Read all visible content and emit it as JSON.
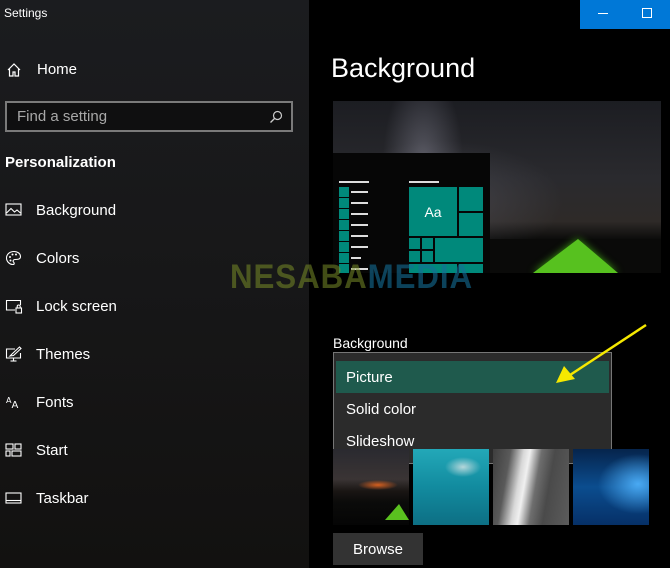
{
  "window": {
    "title": "Settings",
    "controls": {
      "minimize": "minimize",
      "maximize": "maximize"
    },
    "accent_color": "#0078d7"
  },
  "sidebar": {
    "home_label": "Home",
    "search": {
      "placeholder": "Find a setting",
      "value": ""
    },
    "section_title": "Personalization",
    "items": [
      {
        "label": "Background",
        "icon": "picture-icon"
      },
      {
        "label": "Colors",
        "icon": "palette-icon"
      },
      {
        "label": "Lock screen",
        "icon": "lock-screen-icon"
      },
      {
        "label": "Themes",
        "icon": "themes-icon"
      },
      {
        "label": "Fonts",
        "icon": "fonts-icon"
      },
      {
        "label": "Start",
        "icon": "start-icon"
      },
      {
        "label": "Taskbar",
        "icon": "taskbar-icon"
      }
    ]
  },
  "main": {
    "page_title": "Background",
    "preview": {
      "tile_text": "Aa",
      "tile_color": "#00897b"
    },
    "background_label": "Background",
    "dropdown": {
      "selected": "Picture",
      "options": [
        "Picture",
        "Solid color",
        "Slideshow"
      ],
      "highlight_color": "#1f5a4d"
    },
    "thumbnails": [
      "night-sky-tent",
      "underwater-swimmer",
      "rock-waterfall",
      "windows-logo-blue"
    ],
    "browse_label": "Browse"
  },
  "annotation": {
    "arrow_color": "#f5e800"
  },
  "watermark": {
    "part1": "NESABA",
    "part2": "MEDIA"
  }
}
